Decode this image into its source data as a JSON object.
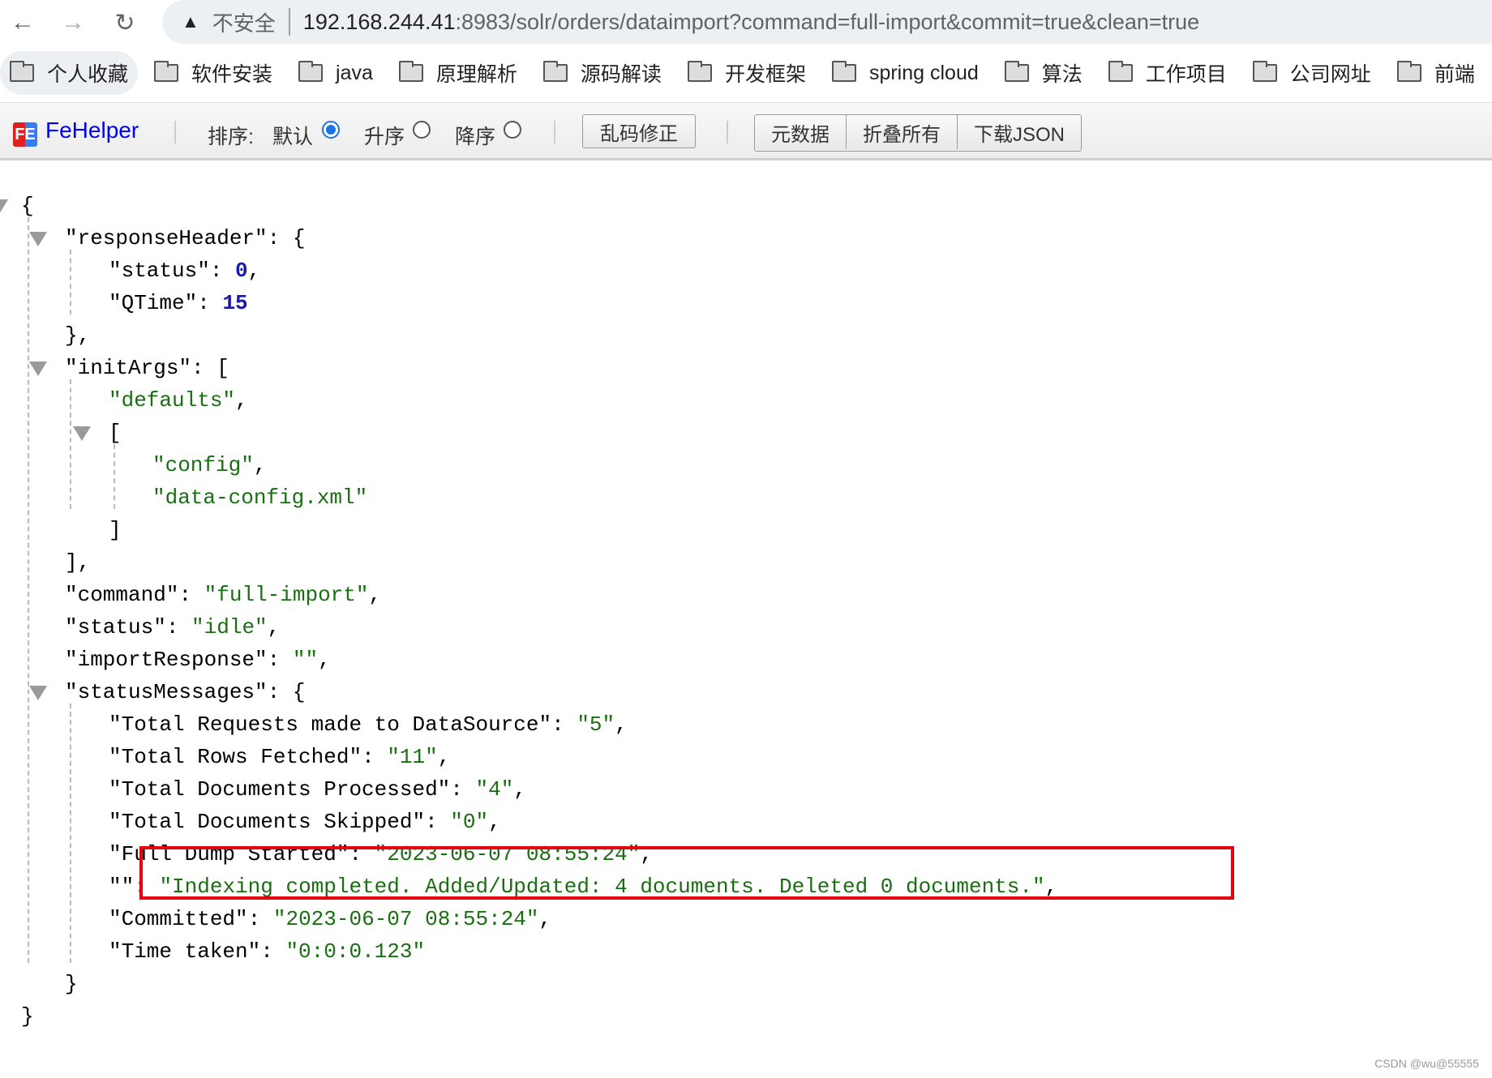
{
  "browser": {
    "security_label": "不安全",
    "url_host": "192.168.244.41",
    "url_rest": ":8983/solr/orders/dataimport?command=full-import&commit=true&clean=true"
  },
  "bookmarks": [
    "个人收藏",
    "软件安装",
    "java",
    "原理解析",
    "源码解读",
    "开发框架",
    "spring cloud",
    "算法",
    "工作项目",
    "公司网址",
    "前端"
  ],
  "fehelper": {
    "logo_text": "FE",
    "name": "FeHelper",
    "sort_label": "排序:",
    "sort_options": [
      {
        "label": "默认",
        "selected": true
      },
      {
        "label": "升序",
        "selected": false
      },
      {
        "label": "降序",
        "selected": false
      }
    ],
    "fix_encoding_label": "乱码修正",
    "metadata_label": "元数据",
    "collapse_all_label": "折叠所有",
    "download_json_label": "下载JSON",
    "accent_color": "#0000ee"
  },
  "json_lines": [
    {
      "indent": 0,
      "parts": [
        [
          "p",
          "{"
        ]
      ],
      "toggle": true
    },
    {
      "indent": 1,
      "parts": [
        [
          "k",
          "\"responseHeader\""
        ],
        [
          "p",
          ": {"
        ]
      ],
      "toggle": true
    },
    {
      "indent": 2,
      "parts": [
        [
          "k",
          "\"status\""
        ],
        [
          "p",
          ": "
        ],
        [
          "n",
          "0"
        ],
        [
          "p",
          ","
        ]
      ]
    },
    {
      "indent": 2,
      "parts": [
        [
          "k",
          "\"QTime\""
        ],
        [
          "p",
          ": "
        ],
        [
          "n",
          "15"
        ]
      ]
    },
    {
      "indent": 1,
      "parts": [
        [
          "p",
          "},"
        ]
      ]
    },
    {
      "indent": 1,
      "parts": [
        [
          "k",
          "\"initArgs\""
        ],
        [
          "p",
          ": ["
        ]
      ],
      "toggle": true
    },
    {
      "indent": 2,
      "parts": [
        [
          "s",
          "\"defaults\""
        ],
        [
          "p",
          ","
        ]
      ]
    },
    {
      "indent": 2,
      "parts": [
        [
          "p",
          "["
        ]
      ],
      "toggle": true
    },
    {
      "indent": 3,
      "parts": [
        [
          "s",
          "\"config\""
        ],
        [
          "p",
          ","
        ]
      ]
    },
    {
      "indent": 3,
      "parts": [
        [
          "s",
          "\"data-config.xml\""
        ]
      ]
    },
    {
      "indent": 2,
      "parts": [
        [
          "p",
          "]"
        ]
      ]
    },
    {
      "indent": 1,
      "parts": [
        [
          "p",
          "],"
        ]
      ]
    },
    {
      "indent": 1,
      "parts": [
        [
          "k",
          "\"command\""
        ],
        [
          "p",
          ": "
        ],
        [
          "s",
          "\"full-import\""
        ],
        [
          "p",
          ","
        ]
      ]
    },
    {
      "indent": 1,
      "parts": [
        [
          "k",
          "\"status\""
        ],
        [
          "p",
          ": "
        ],
        [
          "s",
          "\"idle\""
        ],
        [
          "p",
          ","
        ]
      ]
    },
    {
      "indent": 1,
      "parts": [
        [
          "k",
          "\"importResponse\""
        ],
        [
          "p",
          ": "
        ],
        [
          "s",
          "\"\""
        ],
        [
          "p",
          ","
        ]
      ]
    },
    {
      "indent": 1,
      "parts": [
        [
          "k",
          "\"statusMessages\""
        ],
        [
          "p",
          ": {"
        ]
      ],
      "toggle": true
    },
    {
      "indent": 2,
      "parts": [
        [
          "k",
          "\"Total Requests made to DataSource\""
        ],
        [
          "p",
          ": "
        ],
        [
          "s",
          "\"5\""
        ],
        [
          "p",
          ","
        ]
      ]
    },
    {
      "indent": 2,
      "parts": [
        [
          "k",
          "\"Total Rows Fetched\""
        ],
        [
          "p",
          ": "
        ],
        [
          "s",
          "\"11\""
        ],
        [
          "p",
          ","
        ]
      ]
    },
    {
      "indent": 2,
      "parts": [
        [
          "k",
          "\"Total Documents Processed\""
        ],
        [
          "p",
          ": "
        ],
        [
          "s",
          "\"4\""
        ],
        [
          "p",
          ","
        ]
      ]
    },
    {
      "indent": 2,
      "parts": [
        [
          "k",
          "\"Total Documents Skipped\""
        ],
        [
          "p",
          ": "
        ],
        [
          "s",
          "\"0\""
        ],
        [
          "p",
          ","
        ]
      ]
    },
    {
      "indent": 2,
      "parts": [
        [
          "k",
          "\"Full Dump Started\""
        ],
        [
          "p",
          ": "
        ],
        [
          "s",
          "\"2023-06-07 08:55:24\""
        ],
        [
          "p",
          ","
        ]
      ]
    },
    {
      "indent": 2,
      "parts": [
        [
          "k",
          "\"\""
        ],
        [
          "p",
          ": "
        ],
        [
          "s",
          "\"Indexing completed. Added/Updated: 4 documents. Deleted 0 documents.\""
        ],
        [
          "p",
          ","
        ]
      ],
      "highlighted": true
    },
    {
      "indent": 2,
      "parts": [
        [
          "k",
          "\"Committed\""
        ],
        [
          "p",
          ": "
        ],
        [
          "s",
          "\"2023-06-07 08:55:24\""
        ],
        [
          "p",
          ","
        ]
      ]
    },
    {
      "indent": 2,
      "parts": [
        [
          "k",
          "\"Time taken\""
        ],
        [
          "p",
          ": "
        ],
        [
          "s",
          "\"0:0:0.123\""
        ]
      ]
    },
    {
      "indent": 1,
      "parts": [
        [
          "p",
          "}"
        ]
      ]
    },
    {
      "indent": 0,
      "parts": [
        [
          "p",
          "}"
        ]
      ]
    }
  ],
  "colors": {
    "string": "#1a6e12",
    "number": "#1a1aa6",
    "highlight": "#e4000f"
  },
  "watermark": "CSDN @wu@55555"
}
